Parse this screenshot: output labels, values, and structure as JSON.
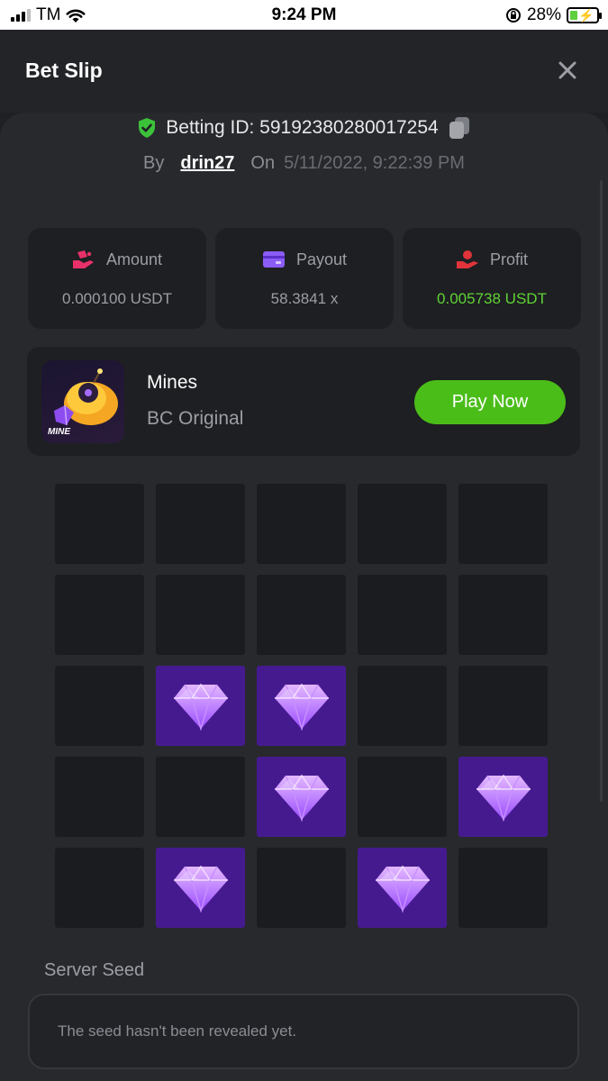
{
  "status_bar": {
    "carrier": "TM",
    "time": "9:24 PM",
    "battery": "28%",
    "battery_level": 0.28
  },
  "header": {
    "title": "Bet Slip",
    "close_icon": "close-icon"
  },
  "bet": {
    "id_label": "Betting ID: 59192380280017254",
    "by_label": "By",
    "user": "drin27",
    "on_label": "On",
    "date": "5/11/2022, 9:22:39 PM"
  },
  "stats": [
    {
      "label": "Amount",
      "value": "0.000100 USDT",
      "icon": "wallet-hand-icon",
      "color": "#e8316a"
    },
    {
      "label": "Payout",
      "value": "58.3841 x",
      "icon": "card-icon",
      "color": "#8b5cf6"
    },
    {
      "label": "Profit",
      "value": "0.005738 USDT",
      "icon": "profit-hand-icon",
      "color": "#e0343a"
    }
  ],
  "game": {
    "name": "Mines",
    "provider": "BC Original",
    "play_label": "Play Now",
    "thumb_text": "MINE"
  },
  "board": {
    "gems": [
      [
        0,
        0,
        0,
        0,
        0
      ],
      [
        0,
        0,
        0,
        0,
        0
      ],
      [
        0,
        1,
        1,
        0,
        0
      ],
      [
        0,
        0,
        1,
        0,
        1
      ],
      [
        0,
        1,
        0,
        1,
        0
      ]
    ]
  },
  "server_seed": {
    "label": "Server Seed",
    "text": "The seed hasn't been revealed yet."
  },
  "colors": {
    "accent_green": "#4bbd19",
    "profit_green": "#5fd335",
    "gem_tile": "#461a8f"
  }
}
